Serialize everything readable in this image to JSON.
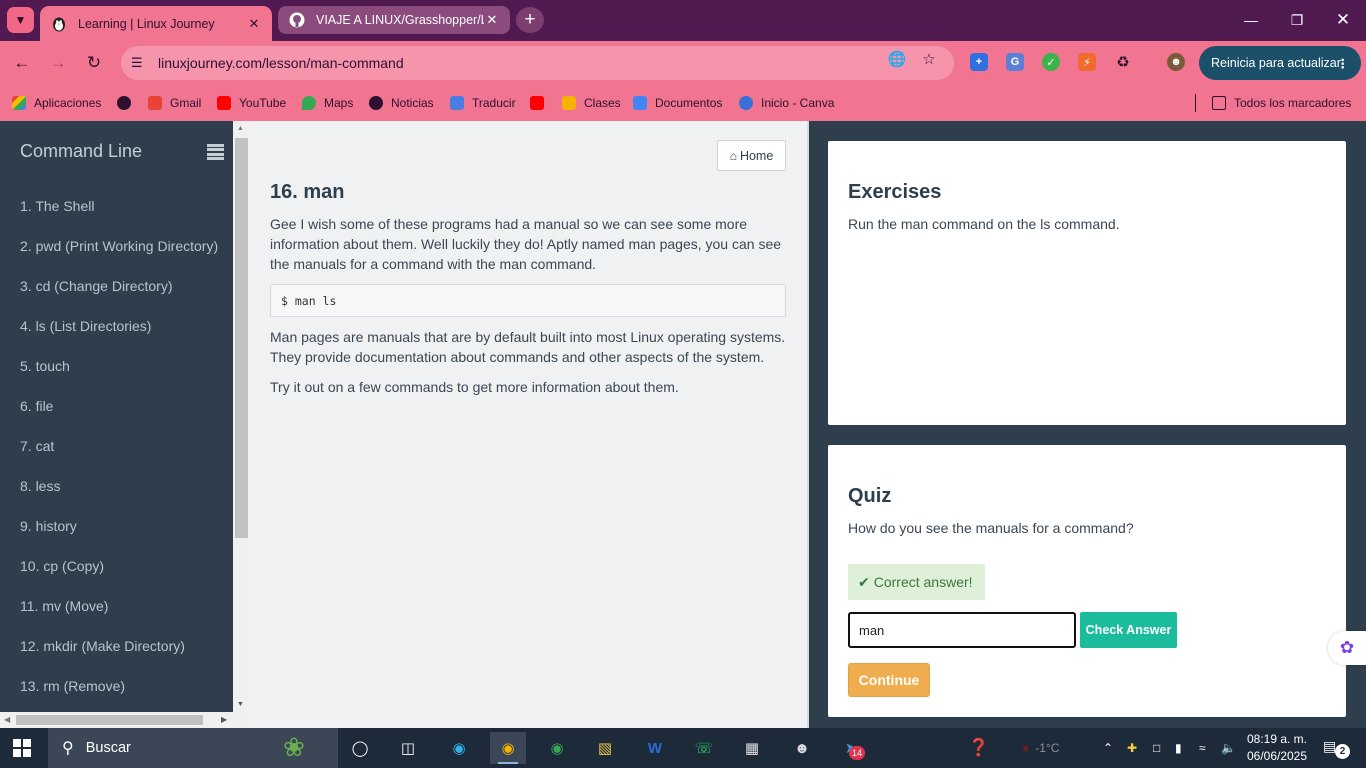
{
  "browser": {
    "tabs": [
      {
        "title": "Learning | Linux Journey",
        "active": true
      },
      {
        "title": "VIAJE A LINUX/Grasshopper/Li",
        "active": false
      }
    ],
    "url": "linuxjourney.com/lesson/man-command",
    "update_button": "Reinicia para actualizar",
    "bookmarks": [
      "Aplicaciones",
      "Gmail",
      "YouTube",
      "Maps",
      "Noticias",
      "Traducir",
      "Clases",
      "Documentos",
      "Inicio - Canva"
    ],
    "all_bookmarks": "Todos los marcadores"
  },
  "sidebar": {
    "title": "Command Line",
    "lessons": [
      "1. The Shell",
      "2. pwd (Print Working Directory)",
      "3. cd (Change Directory)",
      "4. ls (List Directories)",
      "5. touch",
      "6. file",
      "7. cat",
      "8. less",
      "9. history",
      "10. cp (Copy)",
      "11. mv (Move)",
      "12. mkdir (Make Directory)",
      "13. rm (Remove)"
    ]
  },
  "lesson": {
    "home_label": "Home",
    "title": "16. man",
    "intro": "Gee I wish some of these programs had a manual so we can see some more information about them. Well luckily they do! Aptly named man pages, you can see the manuals for a command with the man command.",
    "code": "$ man ls",
    "body": "Man pages are manuals that are by default built into most Linux operating systems. They provide documentation about commands and other aspects of the system.",
    "outro": "Try it out on a few commands to get more information about them."
  },
  "exercises": {
    "title": "Exercises",
    "text": "Run the man command on the ls command."
  },
  "quiz": {
    "title": "Quiz",
    "question": "How do you see the manuals for a command?",
    "feedback": "Correct answer!",
    "answer_value": "man",
    "check_label": "Check Answer",
    "continue_label": "Continue"
  },
  "taskbar": {
    "search_placeholder": "Buscar",
    "telegram_badge": "14",
    "weather": "-1°C",
    "time": "08:19 a. m.",
    "date": "06/06/2025",
    "notifications": "2"
  },
  "colors": {
    "tabstrip": "#50194f",
    "toolbar": "#f17491",
    "sidebar": "#2f3e4c",
    "check_button": "#1abc9c",
    "continue_button": "#f0ad4e",
    "correct_bg": "#dff0d8"
  }
}
